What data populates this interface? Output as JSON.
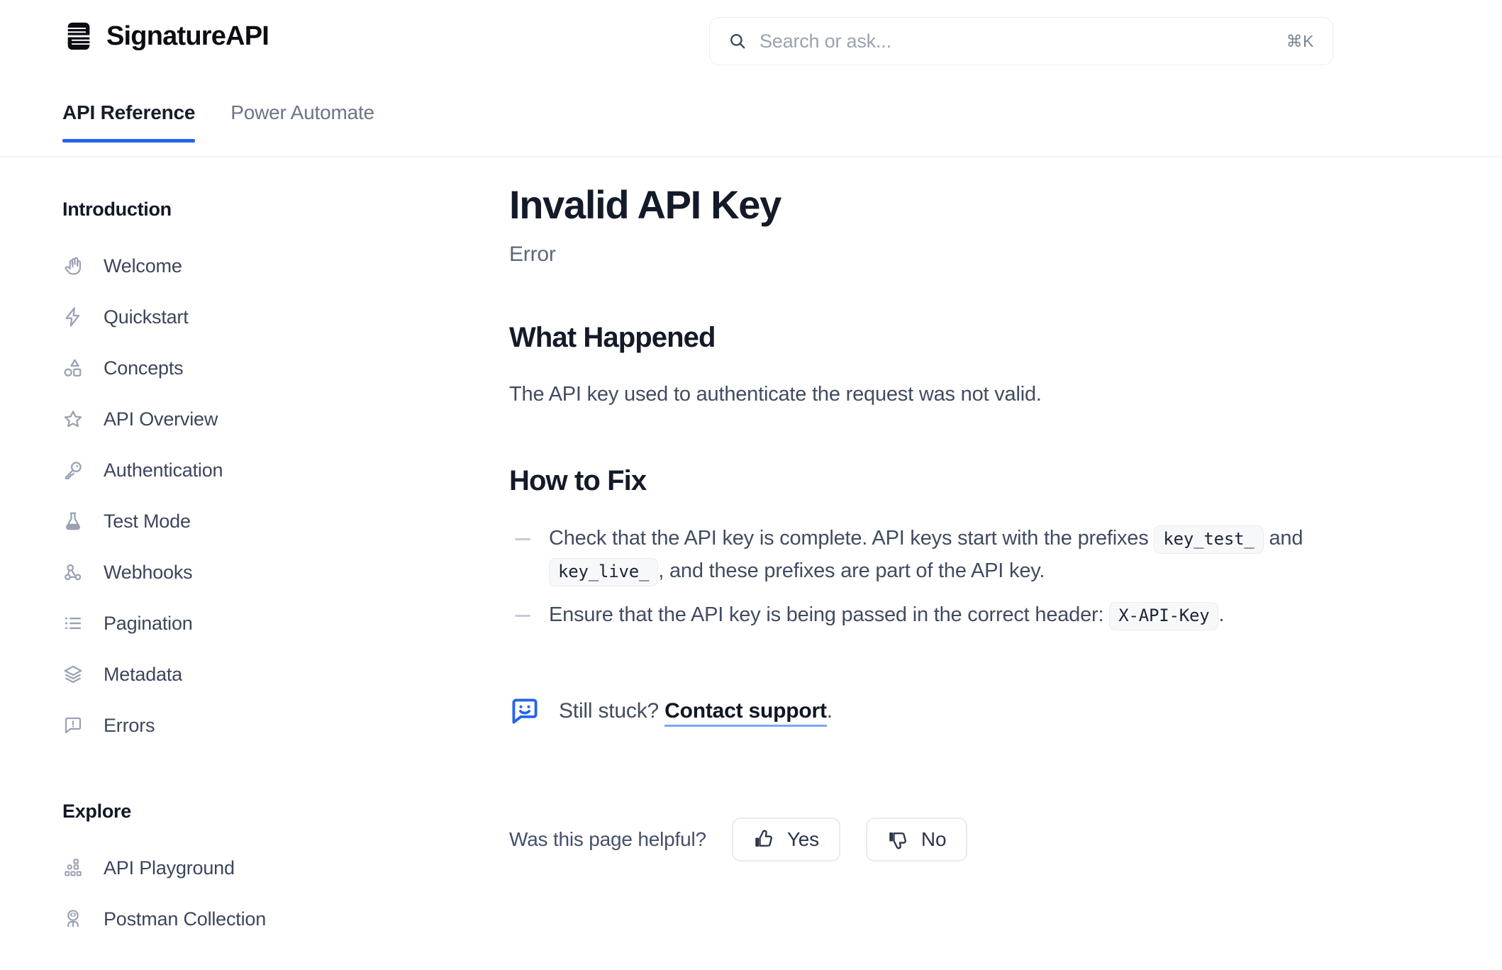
{
  "header": {
    "brand_name": "SignatureAPI",
    "logo_icon": "signature-s-logo",
    "search": {
      "icon": "search-icon",
      "placeholder": "Search or ask...",
      "value": "",
      "shortcut": "⌘K"
    }
  },
  "tabs": [
    {
      "label": "API Reference",
      "active": true
    },
    {
      "label": "Power Automate",
      "active": false
    }
  ],
  "sidebar": {
    "groups": [
      {
        "title": "Introduction",
        "items": [
          {
            "label": "Welcome",
            "icon": "waving-hand-icon"
          },
          {
            "label": "Quickstart",
            "icon": "lightning-bolt-icon"
          },
          {
            "label": "Concepts",
            "icon": "shapes-icon"
          },
          {
            "label": "API Overview",
            "icon": "star-icon"
          },
          {
            "label": "Authentication",
            "icon": "key-icon"
          },
          {
            "label": "Test Mode",
            "icon": "flask-icon"
          },
          {
            "label": "Webhooks",
            "icon": "webhook-icon"
          },
          {
            "label": "Pagination",
            "icon": "list-icon"
          },
          {
            "label": "Metadata",
            "icon": "layers-icon"
          },
          {
            "label": "Errors",
            "icon": "message-alert-icon"
          }
        ]
      },
      {
        "title": "Explore",
        "items": [
          {
            "label": "API Playground",
            "icon": "network-nodes-icon"
          },
          {
            "label": "Postman Collection",
            "icon": "astronaut-icon"
          }
        ]
      }
    ]
  },
  "main": {
    "title": "Invalid API Key",
    "subtitle": "Error",
    "sections": [
      {
        "heading": "What Happened",
        "paragraph": "The API key used to authenticate the request was not valid."
      },
      {
        "heading": "How to Fix"
      }
    ],
    "fix_list": [
      {
        "part1": "Check that the API key is complete. API keys start with the prefixes ",
        "code1": "key_test_",
        "part2": " and ",
        "code2": "key_live_",
        "part3": ", and these prefixes are part of the API key."
      },
      {
        "part1": "Ensure that the API key is being passed in the correct header: ",
        "code1": "X-API-Key",
        "part2": "."
      }
    ],
    "still_stuck": {
      "icon": "chat-smile-icon",
      "text": "Still stuck? ",
      "link": "Contact support",
      "suffix": "."
    },
    "feedback": {
      "label": "Was this page helpful?",
      "yes_label": "Yes",
      "yes_icon": "thumbs-up-icon",
      "no_label": "No",
      "no_icon": "thumbs-down-icon"
    }
  },
  "colors": {
    "accent_blue": "#2563eb",
    "text_dark": "#131a28",
    "text_muted": "#5c677b",
    "border_light": "#eceef1"
  }
}
